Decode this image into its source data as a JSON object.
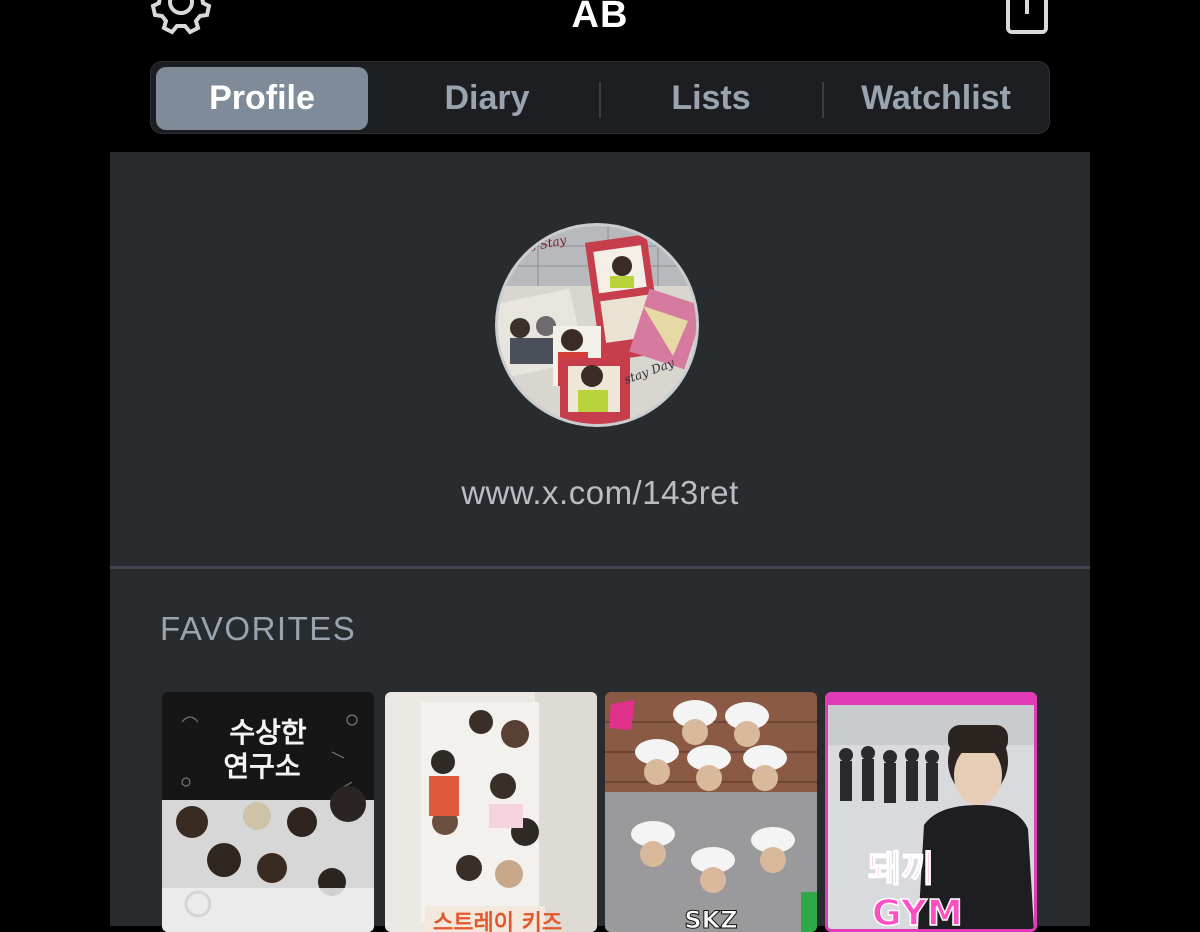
{
  "header": {
    "title": "AB",
    "settings_icon": "gear-icon",
    "share_icon": "share-icon"
  },
  "tabs": [
    {
      "label": "Profile",
      "active": true
    },
    {
      "label": "Diary",
      "active": false
    },
    {
      "label": "Lists",
      "active": false
    },
    {
      "label": "Watchlist",
      "active": false
    }
  ],
  "profile": {
    "link": "www.x.com/143ret",
    "avatar_caption_1": "Let's Stay",
    "avatar_caption_2": "stay Day"
  },
  "favorites": {
    "heading": "FAVORITES",
    "items": [
      {
        "poster_text": "수상한 연구소"
      },
      {
        "poster_text": "스트레이 키즈"
      },
      {
        "poster_text": "SKZ"
      },
      {
        "poster_text": "돼끼 GYM"
      }
    ]
  },
  "colors": {
    "background": "#000000",
    "panel": "#282c2e",
    "tab_active": "#7f8b99",
    "text_muted": "#9aa4ae"
  }
}
